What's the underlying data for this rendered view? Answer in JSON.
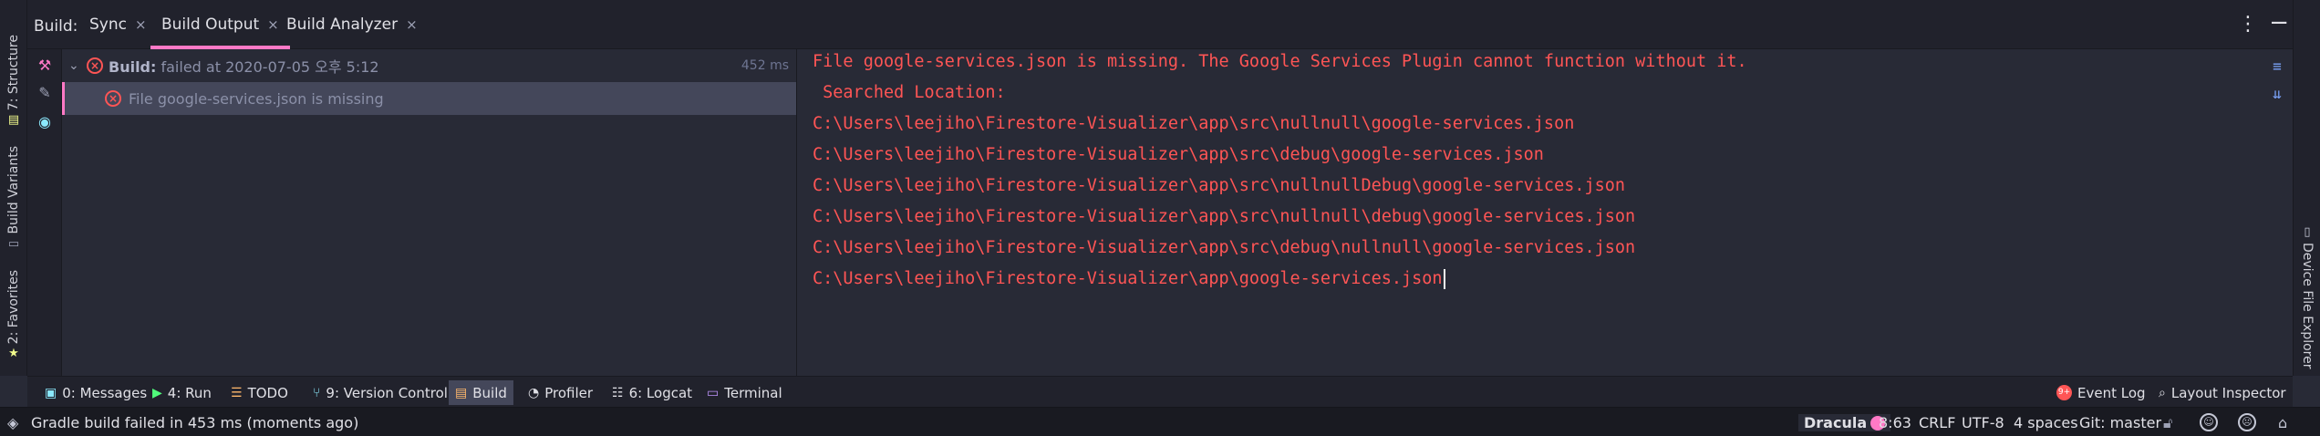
{
  "left_strip": {
    "structure_label": "7: Structure",
    "build_variants_label": "Build Variants",
    "favorites_label": "2: Favorites"
  },
  "right_strip": {
    "device_file_explorer_label": "Device File Explorer"
  },
  "tabbar": {
    "prefix": "Build:",
    "tabs": [
      {
        "label": "Sync",
        "close": "×"
      },
      {
        "label": "Build Output",
        "close": "×"
      },
      {
        "label": "Build Analyzer",
        "close": "×"
      }
    ],
    "more": "⋮"
  },
  "tree": {
    "root": {
      "title": "Build:",
      "status": " failed at 2020-07-05 오후 5:12",
      "time": "452 ms"
    },
    "child": {
      "text": "File google-services.json is missing"
    }
  },
  "console": {
    "lines": [
      "File google-services.json is missing. The Google Services Plugin cannot function without it.",
      " Searched Location:",
      "C:\\Users\\leejiho\\Firestore-Visualizer\\app\\src\\nullnull\\google-services.json",
      "C:\\Users\\leejiho\\Firestore-Visualizer\\app\\src\\debug\\google-services.json",
      "C:\\Users\\leejiho\\Firestore-Visualizer\\app\\src\\nullnullDebug\\google-services.json",
      "C:\\Users\\leejiho\\Firestore-Visualizer\\app\\src\\nullnull\\debug\\google-services.json",
      "C:\\Users\\leejiho\\Firestore-Visualizer\\app\\src\\debug\\nullnull\\google-services.json",
      "C:\\Users\\leejiho\\Firestore-Visualizer\\app\\google-services.json"
    ]
  },
  "bottom_tabs": [
    {
      "label": "0: Messages",
      "icon": "messages-icon"
    },
    {
      "label": "4: Run",
      "icon": "run-icon"
    },
    {
      "label": "TODO",
      "icon": "todo-icon"
    },
    {
      "label": "9: Version Control",
      "icon": "version-control-icon"
    },
    {
      "label": "Build",
      "icon": "build-icon"
    },
    {
      "label": "Profiler",
      "icon": "profiler-icon"
    },
    {
      "label": "6: Logcat",
      "icon": "logcat-icon"
    },
    {
      "label": "Terminal",
      "icon": "terminal-icon"
    }
  ],
  "bottom_right": {
    "event_log": "Event Log",
    "event_log_badge": "9+",
    "layout_inspector": "Layout Inspector"
  },
  "status": {
    "message": "Gradle build failed in 453 ms (moments ago)",
    "theme": "Dracula",
    "position": "8:63",
    "line_sep": "CRLF",
    "encoding": "UTF-8",
    "indent": "4 spaces",
    "git": "Git: master"
  },
  "colors": {
    "accent": "#ff79c6",
    "error": "#ff5555",
    "background": "#282a36",
    "panel": "#21222c"
  }
}
